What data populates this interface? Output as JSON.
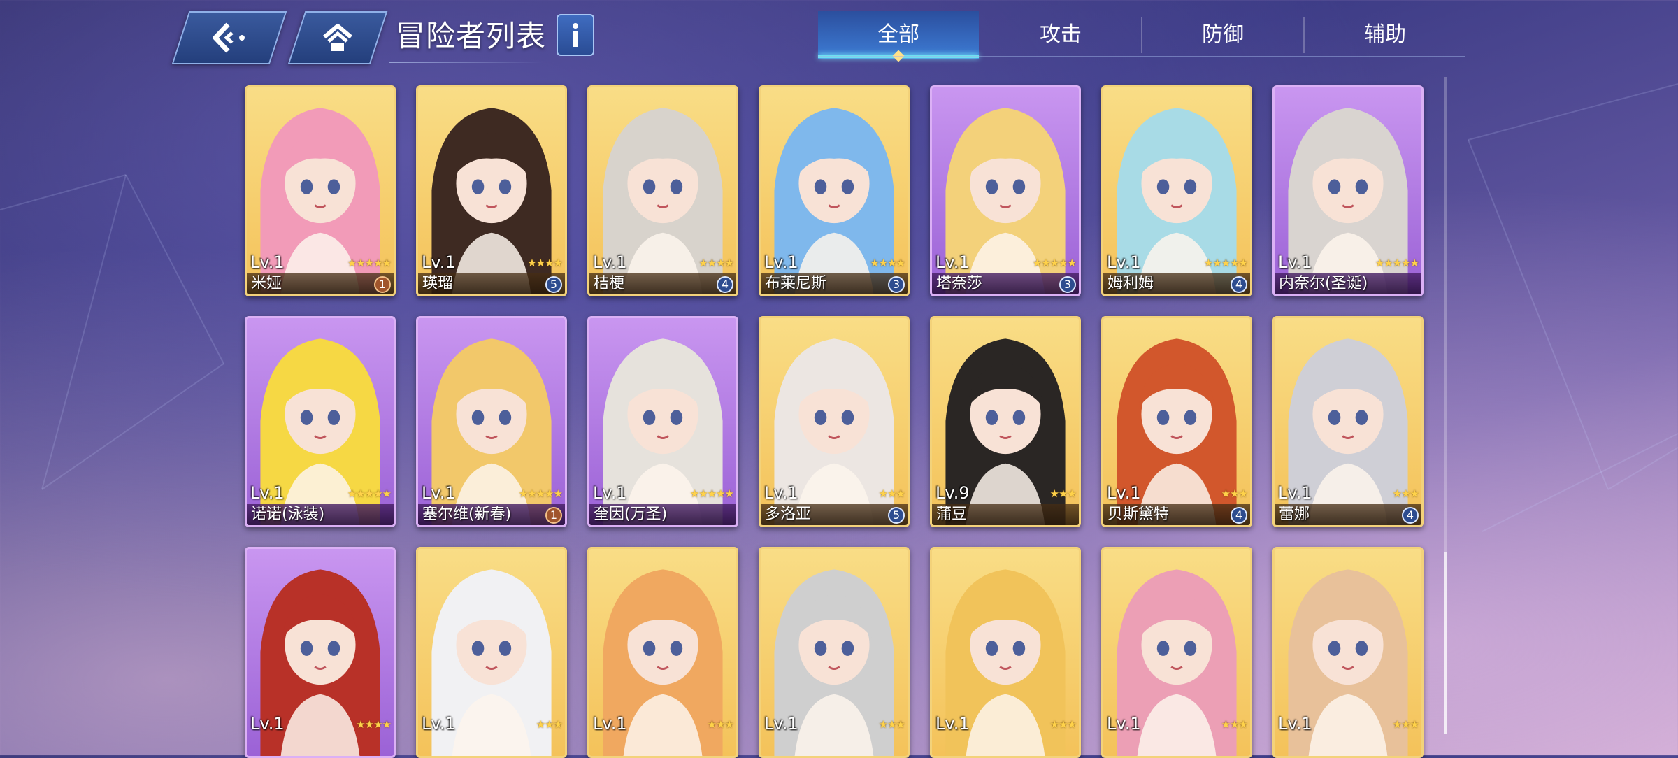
{
  "header": {
    "title": "冒险者列表",
    "back_icon": "back-arrow-icon",
    "home_icon": "home-icon",
    "info_icon": "info-icon"
  },
  "tabs": [
    {
      "label": "全部",
      "active": true
    },
    {
      "label": "攻击",
      "active": false
    },
    {
      "label": "防御",
      "active": false
    },
    {
      "label": "辅助",
      "active": false
    }
  ],
  "colors": {
    "card_gold": "#f4c25a",
    "card_purple": "#9b62d6",
    "tab_active": "#6ee0f0"
  },
  "adventurers": [
    {
      "level": "Lv.1",
      "name": "米娅",
      "stars": "★★★★★",
      "rank": "1",
      "frame": "gold",
      "hair": "#f29bb8"
    },
    {
      "level": "Lv.1",
      "name": "瑛瑠",
      "stars": "★★★★",
      "rank": "5",
      "frame": "gold",
      "hair": "#3e2a22"
    },
    {
      "level": "Lv.1",
      "name": "桔梗",
      "stars": "★★★★",
      "rank": "4",
      "frame": "gold",
      "hair": "#d8d3cc"
    },
    {
      "level": "Lv.1",
      "name": "布莱尼斯",
      "stars": "★★★★",
      "rank": "3",
      "frame": "gold",
      "hair": "#7fb8ec"
    },
    {
      "level": "Lv.1",
      "name": "塔奈莎",
      "stars": "★★★★★",
      "rank": "3",
      "frame": "purple",
      "hair": "#f3d17a"
    },
    {
      "level": "Lv.1",
      "name": "姆利姆",
      "stars": "★★★★★",
      "rank": "4",
      "frame": "gold",
      "hair": "#a8dbe6"
    },
    {
      "level": "Lv.1",
      "name": "内奈尔(圣诞)",
      "stars": "★★★★★",
      "rank": "",
      "frame": "purple",
      "hair": "#d9d4d0"
    },
    {
      "level": "Lv.1",
      "name": "诺诺(泳装)",
      "stars": "★★★★★",
      "rank": "",
      "frame": "purple",
      "hair": "#f6d844"
    },
    {
      "level": "Lv.1",
      "name": "塞尔维(新春)",
      "stars": "★★★★★",
      "rank": "1",
      "frame": "purple",
      "hair": "#f2c86a"
    },
    {
      "level": "Lv.1",
      "name": "奎因(万圣)",
      "stars": "★★★★★",
      "rank": "",
      "frame": "purple",
      "hair": "#e6e2dc"
    },
    {
      "level": "Lv.1",
      "name": "多洛亚",
      "stars": "★★★",
      "rank": "5",
      "frame": "gold",
      "hair": "#ece6e2"
    },
    {
      "level": "Lv.9",
      "name": "蒲豆",
      "stars": "★★★",
      "rank": "",
      "frame": "gold",
      "hair": "#2a2624"
    },
    {
      "level": "Lv.1",
      "name": "贝斯黛特",
      "stars": "★★★",
      "rank": "4",
      "frame": "gold",
      "hair": "#d2572c"
    },
    {
      "level": "Lv.1",
      "name": "蕾娜",
      "stars": "★★★",
      "rank": "4",
      "frame": "gold",
      "hair": "#cfcfd6"
    },
    {
      "level": "Lv.1",
      "name": "",
      "stars": "★★★★",
      "rank": "",
      "frame": "purple",
      "hair": "#b83128"
    },
    {
      "level": "Lv.1",
      "name": "",
      "stars": "★★★",
      "rank": "",
      "frame": "gold",
      "hair": "#f1f1f3"
    },
    {
      "level": "Lv.1",
      "name": "",
      "stars": "★★★",
      "rank": "",
      "frame": "gold",
      "hair": "#f0a860"
    },
    {
      "level": "Lv.1",
      "name": "",
      "stars": "★★★",
      "rank": "",
      "frame": "gold",
      "hair": "#cfcfcf"
    },
    {
      "level": "Lv.1",
      "name": "",
      "stars": "★★★",
      "rank": "",
      "frame": "gold",
      "hair": "#f1c35a"
    },
    {
      "level": "Lv.1",
      "name": "",
      "stars": "★★★",
      "rank": "",
      "frame": "gold",
      "hair": "#ec9fb5"
    },
    {
      "level": "Lv.1",
      "name": "",
      "stars": "★★★",
      "rank": "",
      "frame": "gold",
      "hair": "#e8c19a"
    }
  ]
}
